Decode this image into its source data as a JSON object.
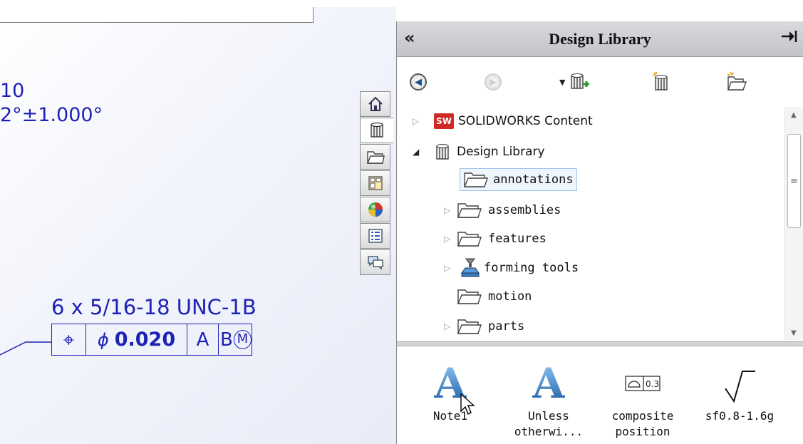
{
  "drawing": {
    "dim_fragment_1": "10",
    "dim_fragment_2": "2°±1.000°",
    "callout": "6 x 5/16-18 UNC-1B",
    "fcf": {
      "symbol": "⌖",
      "diameter": "ϕ",
      "tolerance": "0.020",
      "datum_a": "A",
      "datum_b": "B",
      "modifier": "M"
    }
  },
  "side_tabs": [
    {
      "icon": "home-icon"
    },
    {
      "icon": "design-library-icon"
    },
    {
      "icon": "file-explorer-icon"
    },
    {
      "icon": "view-palette-icon"
    },
    {
      "icon": "appearances-icon"
    },
    {
      "icon": "custom-properties-icon"
    },
    {
      "icon": "forum-icon"
    }
  ],
  "pane": {
    "title": "Design Library",
    "collapse": "«",
    "pin": "⇥"
  },
  "tree": {
    "items": [
      {
        "label": "SOLIDWORKS Content",
        "expander": "▷",
        "icon": "solidworks-icon"
      },
      {
        "label": "Design Library",
        "expander": "◢",
        "icon": "design-library-icon"
      },
      {
        "label": "annotations",
        "expander": "",
        "icon": "folder-icon"
      },
      {
        "label": "assemblies",
        "expander": "▷",
        "icon": "folder-icon"
      },
      {
        "label": "features",
        "expander": "▷",
        "icon": "folder-icon"
      },
      {
        "label": "forming tools",
        "expander": "▷",
        "icon": "forming-tools-icon"
      },
      {
        "label": "motion",
        "expander": "",
        "icon": "folder-icon"
      },
      {
        "label": "parts",
        "expander": "▷",
        "icon": "folder-icon"
      }
    ]
  },
  "items": [
    {
      "label_1": "Note1",
      "label_2": "",
      "icon": "note-icon"
    },
    {
      "label_1": "Unless",
      "label_2": "otherwi...",
      "icon": "note-icon"
    },
    {
      "label_1": "composite",
      "label_2": "position",
      "icon": "profile-tolerance-icon",
      "icon_text": "0.3"
    },
    {
      "label_1": "sf0.8-1.6g",
      "label_2": "",
      "icon": "surface-finish-icon"
    }
  ],
  "colors": {
    "annotation_blue": "#1e22b4",
    "pane_header": "#c8cacf",
    "selection": "#9cc2ec"
  }
}
